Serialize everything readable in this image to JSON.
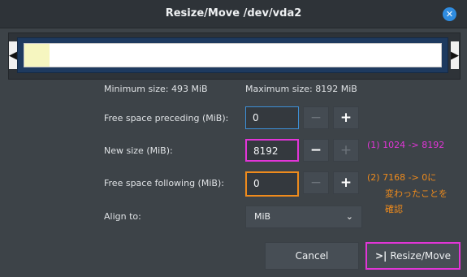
{
  "window": {
    "title": "Resize/Move /dev/vda2",
    "close_glyph": "✕"
  },
  "partition_graphic": {
    "used_fraction": 0.06,
    "left_handle_glyph": "◀",
    "right_handle_glyph": "▶"
  },
  "info": {
    "min_size": "Minimum size: 493 MiB",
    "max_size": "Maximum size: 8192 MiB"
  },
  "fields": {
    "free_preceding": {
      "label": "Free space preceding (MiB):",
      "value": "0"
    },
    "new_size": {
      "label": "New size (MiB):",
      "value": "8192"
    },
    "free_following": {
      "label": "Free space following (MiB):",
      "value": "0"
    },
    "align_to": {
      "label": "Align to:",
      "value": "MiB"
    }
  },
  "stepper": {
    "minus": "−",
    "plus": "+"
  },
  "annotations": {
    "note1": "(1) 1024 -> 8192",
    "note2_line1": "(2) 7168 -> 0に",
    "note2_line2": "変わったことを",
    "note2_line3": "確認"
  },
  "buttons": {
    "cancel": "Cancel",
    "resize_icon": ">|",
    "resize": "Resize/Move"
  },
  "colors": {
    "magenta_highlight": "#e335d8",
    "orange_highlight": "#ef8b1c",
    "accent_blue": "#2f8ce0"
  }
}
